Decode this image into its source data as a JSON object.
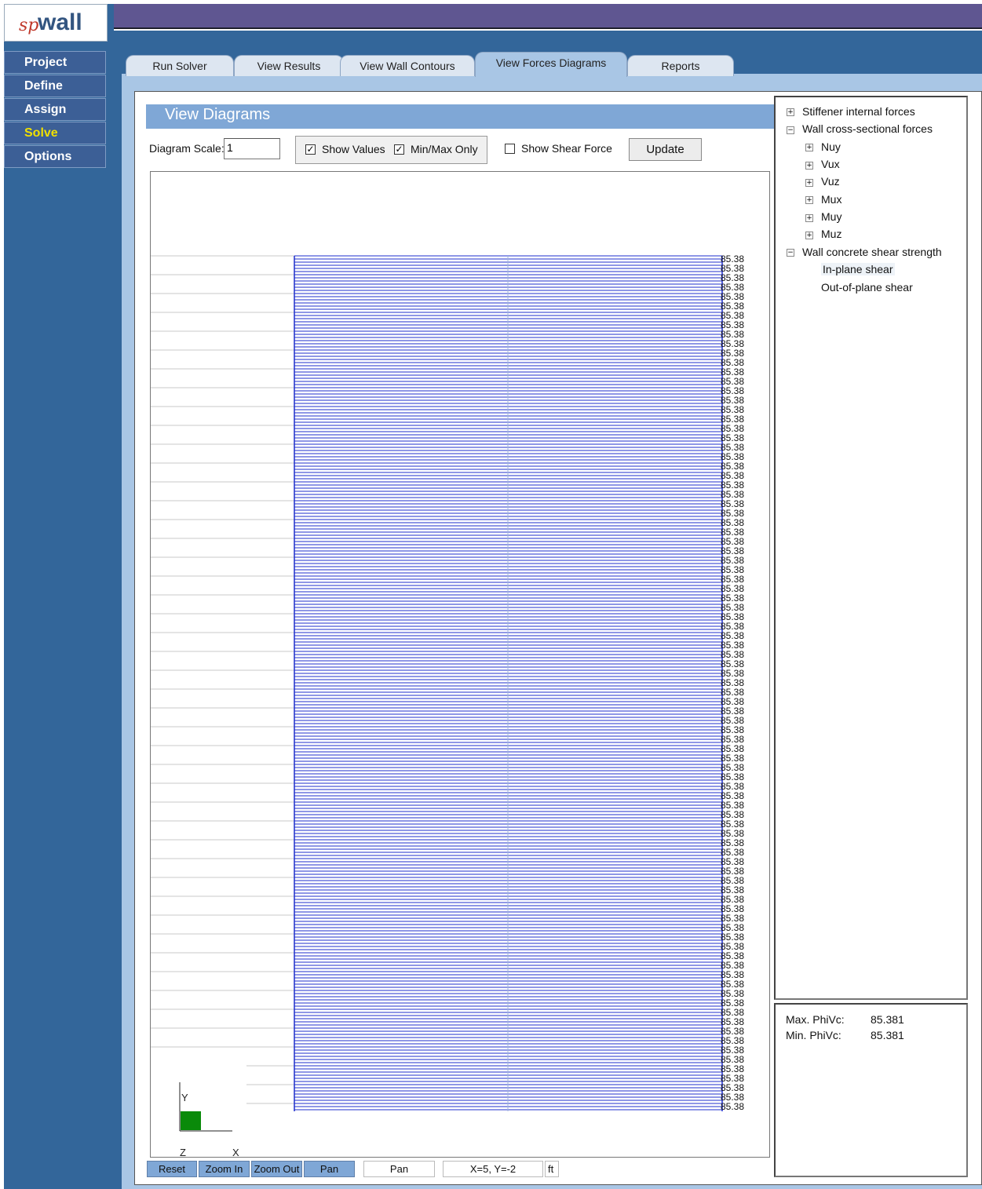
{
  "logo": {
    "sp": "sp",
    "wall": "wall"
  },
  "nav": {
    "items": [
      {
        "label": "Project"
      },
      {
        "label": "Define"
      },
      {
        "label": "Assign"
      },
      {
        "label": "Solve",
        "active": true
      },
      {
        "label": "Options"
      }
    ]
  },
  "tabs": [
    {
      "label": "Run Solver"
    },
    {
      "label": "View Results"
    },
    {
      "label": "View Wall Contours"
    },
    {
      "label": "View Forces Diagrams",
      "active": true
    },
    {
      "label": "Reports"
    }
  ],
  "view": {
    "title": "View Diagrams",
    "scale_label": "Diagram Scale:",
    "scale_value": "1",
    "show_values_label": "Show Values",
    "show_values_checked": true,
    "minmax_label": "Min/Max Only",
    "minmax_checked": true,
    "shear_label": "Show Shear  Force",
    "shear_checked": false,
    "update_label": "Update"
  },
  "diagram": {
    "value_label": "85.38",
    "axes": {
      "y": "Y",
      "z": "Z",
      "x": "X"
    },
    "colors": {
      "lines": "#1f2fcc",
      "grid": "#c8c8c8",
      "axis_box": "#0a8a0a"
    }
  },
  "tree": {
    "nodes": [
      {
        "label": "Stiffener internal forces",
        "expander": "+"
      },
      {
        "label": "Wall cross-sectional forces",
        "expander": "−"
      },
      {
        "label": "Nuy",
        "expander": "+"
      },
      {
        "label": "Vux",
        "expander": "+"
      },
      {
        "label": "Vuz",
        "expander": "+"
      },
      {
        "label": "Mux",
        "expander": "+"
      },
      {
        "label": "Muy",
        "expander": "+"
      },
      {
        "label": "Muz",
        "expander": "+"
      },
      {
        "label": "Wall concrete shear strength",
        "expander": "−"
      },
      {
        "label": "In-plane shear",
        "expander": ""
      },
      {
        "label": "Out-of-plane shear",
        "expander": ""
      }
    ]
  },
  "info": {
    "max_label": "Max. PhiVc:",
    "max_value": "85.381",
    "min_label": "Min. PhiVc:",
    "min_value": "85.381"
  },
  "statusbar": {
    "reset": "Reset",
    "zoom_in": "Zoom In",
    "zoom_out": "Zoom Out",
    "pan": "Pan",
    "mode": "Pan",
    "coords": "X=5, Y=-2",
    "units": "ft"
  }
}
